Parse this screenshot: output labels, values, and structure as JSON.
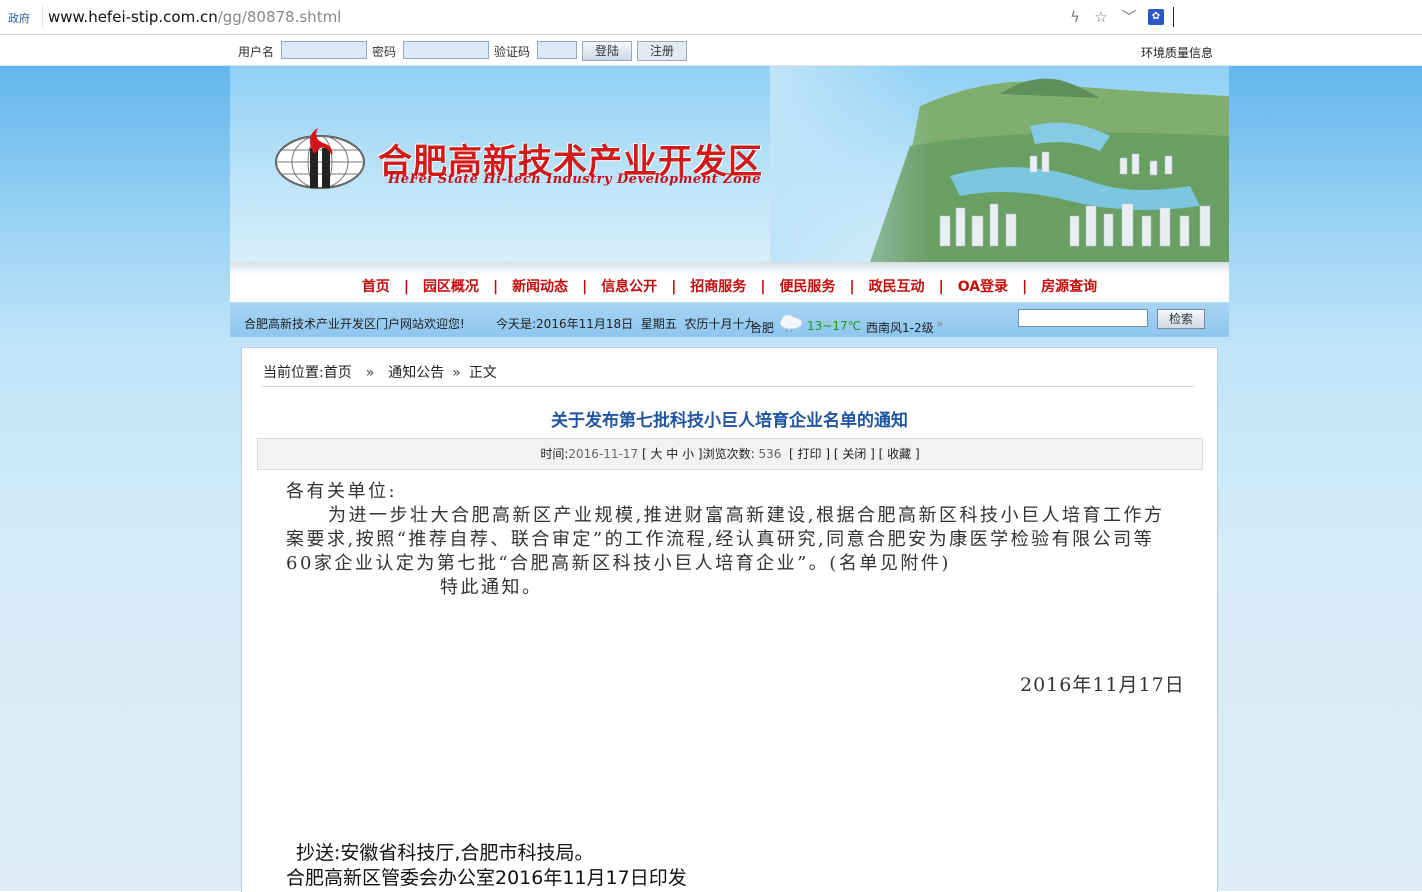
{
  "browser": {
    "site_tag": "政府",
    "url_host": "www.hefei-stip.com.cn",
    "url_path": "/gg/80878.shtml"
  },
  "login_bar": {
    "username_label": "用户名",
    "password_label": "密码",
    "captcha_label": "验证码",
    "login_button": "登陆",
    "register_button": "注册",
    "env_link": "环境质量信息"
  },
  "banner": {
    "title_cn": "合肥高新技术产业开发区",
    "title_en": "HeFei State Hi-tech Industry Development Zone"
  },
  "nav": {
    "items": [
      "首页",
      "园区概况",
      "新闻动态",
      "信息公开",
      "招商服务",
      "便民服务",
      "政民互动",
      "OA登录",
      "房源查询"
    ]
  },
  "info_bar": {
    "welcome": "合肥高新技术产业开发区门户网站欢迎您!",
    "today_prefix": "今天是:",
    "date": "2016年11月18日",
    "weekday": "星期五",
    "lunar": "农历十月十九",
    "city": "合肥",
    "temperature": "13~17℃",
    "wind": "西南风1-2级",
    "more": "»",
    "search_button": "检索"
  },
  "breadcrumb": {
    "prefix": "当前位置:",
    "home": "首页",
    "sep": "»",
    "section": "通知公告",
    "current": "正文"
  },
  "article": {
    "title": "关于发布第七批科技小巨人培育企业名单的通知",
    "meta_time_label": "时间:",
    "meta_time_value": "2016-11-17",
    "meta_size": "[ 大 中 小 ]",
    "meta_views_label": "浏览次数:",
    "meta_views_value": "536",
    "meta_actions": "[ 打印 ] [ 关闭 ] [ 收藏 ]",
    "salutation": "各有关单位:",
    "paragraph": "为进一步壮大合肥高新区产业规模,推进财富高新建设,根据合肥高新区科技小巨人培育工作方案要求,按照“推荐自荐、联合审定”的工作流程,经认真研究,同意合肥安为康医学检验有限公司等60家企业认定为第七批“合肥高新区科技小巨人培育企业”。(名单见附件)",
    "closing": "特此通知。",
    "date": "2016年11月17日",
    "cc": "抄送:安徽省科技厅,合肥市科技局。",
    "issuer": "合肥高新区管委会办公室2016年11月17日印发"
  }
}
